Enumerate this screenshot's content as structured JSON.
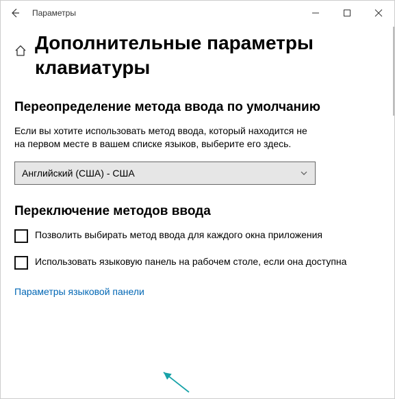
{
  "window": {
    "title": "Параметры"
  },
  "page": {
    "heading": "Дополнительные параметры клавиатуры"
  },
  "section1": {
    "title": "Переопределение метода ввода по умолчанию",
    "description": "Если вы хотите использовать метод ввода, который находится не на первом месте в вашем списке языков, выберите его здесь.",
    "dropdown_value": "Английский (США) - США"
  },
  "section2": {
    "title": "Переключение методов ввода",
    "checkbox1_label": "Позволить выбирать метод ввода для каждого окна приложения",
    "checkbox2_label": "Использовать языковую панель на рабочем столе, если она доступна",
    "link_text": "Параметры языковой панели"
  }
}
